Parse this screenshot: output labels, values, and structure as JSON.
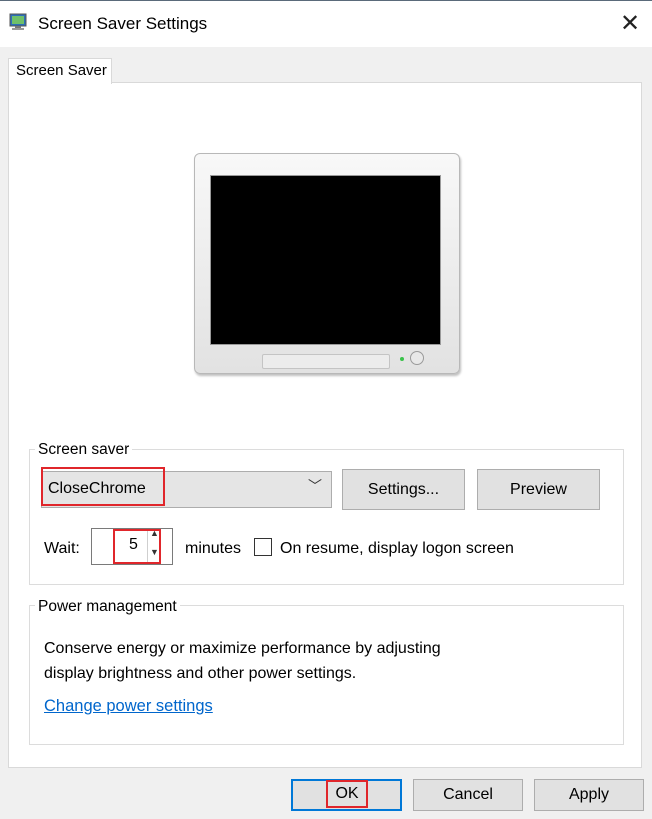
{
  "window": {
    "title": "Screen Saver Settings",
    "close_glyph": "✕"
  },
  "tabs": [
    {
      "label": "Screen Saver"
    }
  ],
  "screen_saver_group": {
    "legend": "Screen saver",
    "selected_saver": "CloseChrome",
    "dropdown_arrow": "﹀",
    "settings_button": "Settings...",
    "preview_button": "Preview",
    "wait_label": "Wait:",
    "wait_value": "5",
    "wait_units": "minutes",
    "on_resume_label": "On resume, display logon screen",
    "on_resume_checked": false
  },
  "power_group": {
    "legend": "Power management",
    "description_line1": "Conserve energy or maximize performance by adjusting",
    "description_line2": "display brightness and other power settings.",
    "link": "Change power settings"
  },
  "footer": {
    "ok": "OK",
    "cancel": "Cancel",
    "apply": "Apply"
  },
  "colors": {
    "highlight": "#e0262b",
    "link": "#0066cc",
    "accent_border": "#0078d7"
  }
}
